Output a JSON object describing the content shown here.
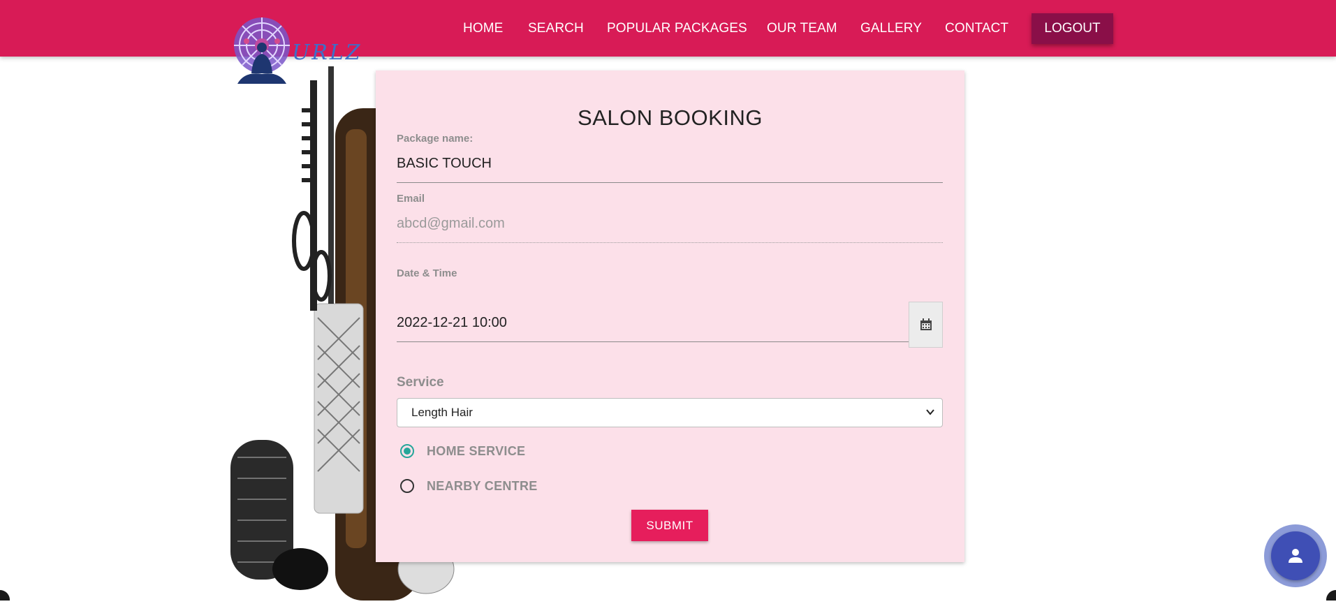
{
  "nav": {
    "links": [
      "HOME",
      "SEARCH",
      "POPULAR PACKAGES",
      "OUR TEAM",
      "GALLERY",
      "CONTACT"
    ],
    "logout_label": "LOGOUT"
  },
  "logo": {
    "text": "URLZ"
  },
  "form": {
    "title": "SALON BOOKING",
    "package_label": "Package name:",
    "package_value": "BASIC TOUCH",
    "email_label": "Email",
    "email_placeholder": "abcd@gmail.com",
    "datetime_label": "Date & Time",
    "datetime_value": "2022-12-21 10:00",
    "service_label": "Service",
    "service_selected": "Length Hair",
    "radio_home_label": "HOME SERVICE",
    "radio_centre_label": "NEARBY CENTRE",
    "submit_label": "SUBMIT"
  },
  "colors": {
    "navbar": "#d81b56",
    "logout": "#8a0f48",
    "card": "#fce0e9",
    "submit": "#e61e5c",
    "radio_checked": "#26a69a",
    "fab": "#3f4fb5"
  },
  "icons": {
    "calendar": "calendar-icon",
    "chevron": "chevron-down-icon",
    "user": "user-icon"
  }
}
